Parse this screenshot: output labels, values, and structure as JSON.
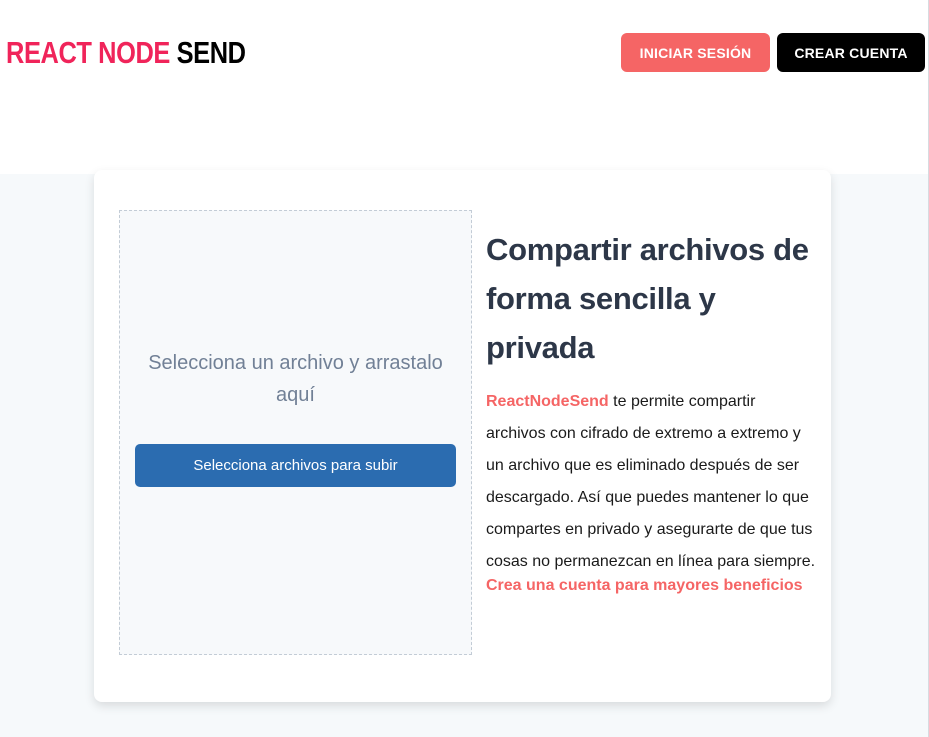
{
  "header": {
    "logo": {
      "part1": "REACT NODE",
      "part2": "SEND"
    },
    "login_label": "Iniciar Sesión",
    "signup_label": "Crear Cuenta"
  },
  "uploader": {
    "prompt": "Selecciona un archivo y arrastalo aquí",
    "button_label": "Selecciona archivos para subir"
  },
  "info": {
    "headline": "Compartir archivos de forma sencilla y privada",
    "brand": "ReactNodeSend",
    "description": " te permite compartir archivos con cifrado de extremo a extremo y un archivo que es eliminado después de ser descargado. Así que puedes mantener lo que compartes en privado y asegurarte de que tus cosas no permanezcan en línea para siempre.",
    "cta": "Crea una cuenta para mayores beneficios"
  },
  "colors": {
    "accent": "#f56565",
    "logo_accent": "#f0245a",
    "primary_button": "#2b6cb0",
    "heading": "#2d3748",
    "background": "#f6f9fb"
  }
}
